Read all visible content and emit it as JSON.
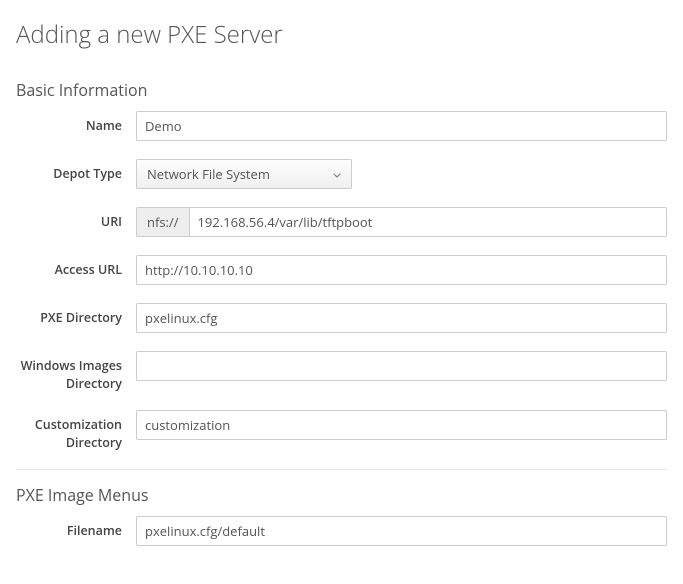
{
  "page_title": "Adding a new PXE Server",
  "sections": {
    "basic": {
      "title": "Basic Information",
      "fields": {
        "name": {
          "label": "Name",
          "value": "Demo"
        },
        "depot_type": {
          "label": "Depot Type",
          "selected": "Network File System"
        },
        "uri": {
          "label": "URI",
          "prefix": "nfs://",
          "value": "192.168.56.4/var/lib/tftpboot"
        },
        "access_url": {
          "label": "Access URL",
          "value": "http://10.10.10.10"
        },
        "pxe_directory": {
          "label": "PXE Directory",
          "value": "pxelinux.cfg"
        },
        "windows_images_directory": {
          "label": "Windows Images Directory",
          "value": ""
        },
        "customization_directory": {
          "label": "Customization Directory",
          "value": "customization"
        }
      }
    },
    "pxe_menus": {
      "title": "PXE Image Menus",
      "fields": {
        "filename": {
          "label": "Filename",
          "value": "pxelinux.cfg/default"
        }
      }
    }
  }
}
